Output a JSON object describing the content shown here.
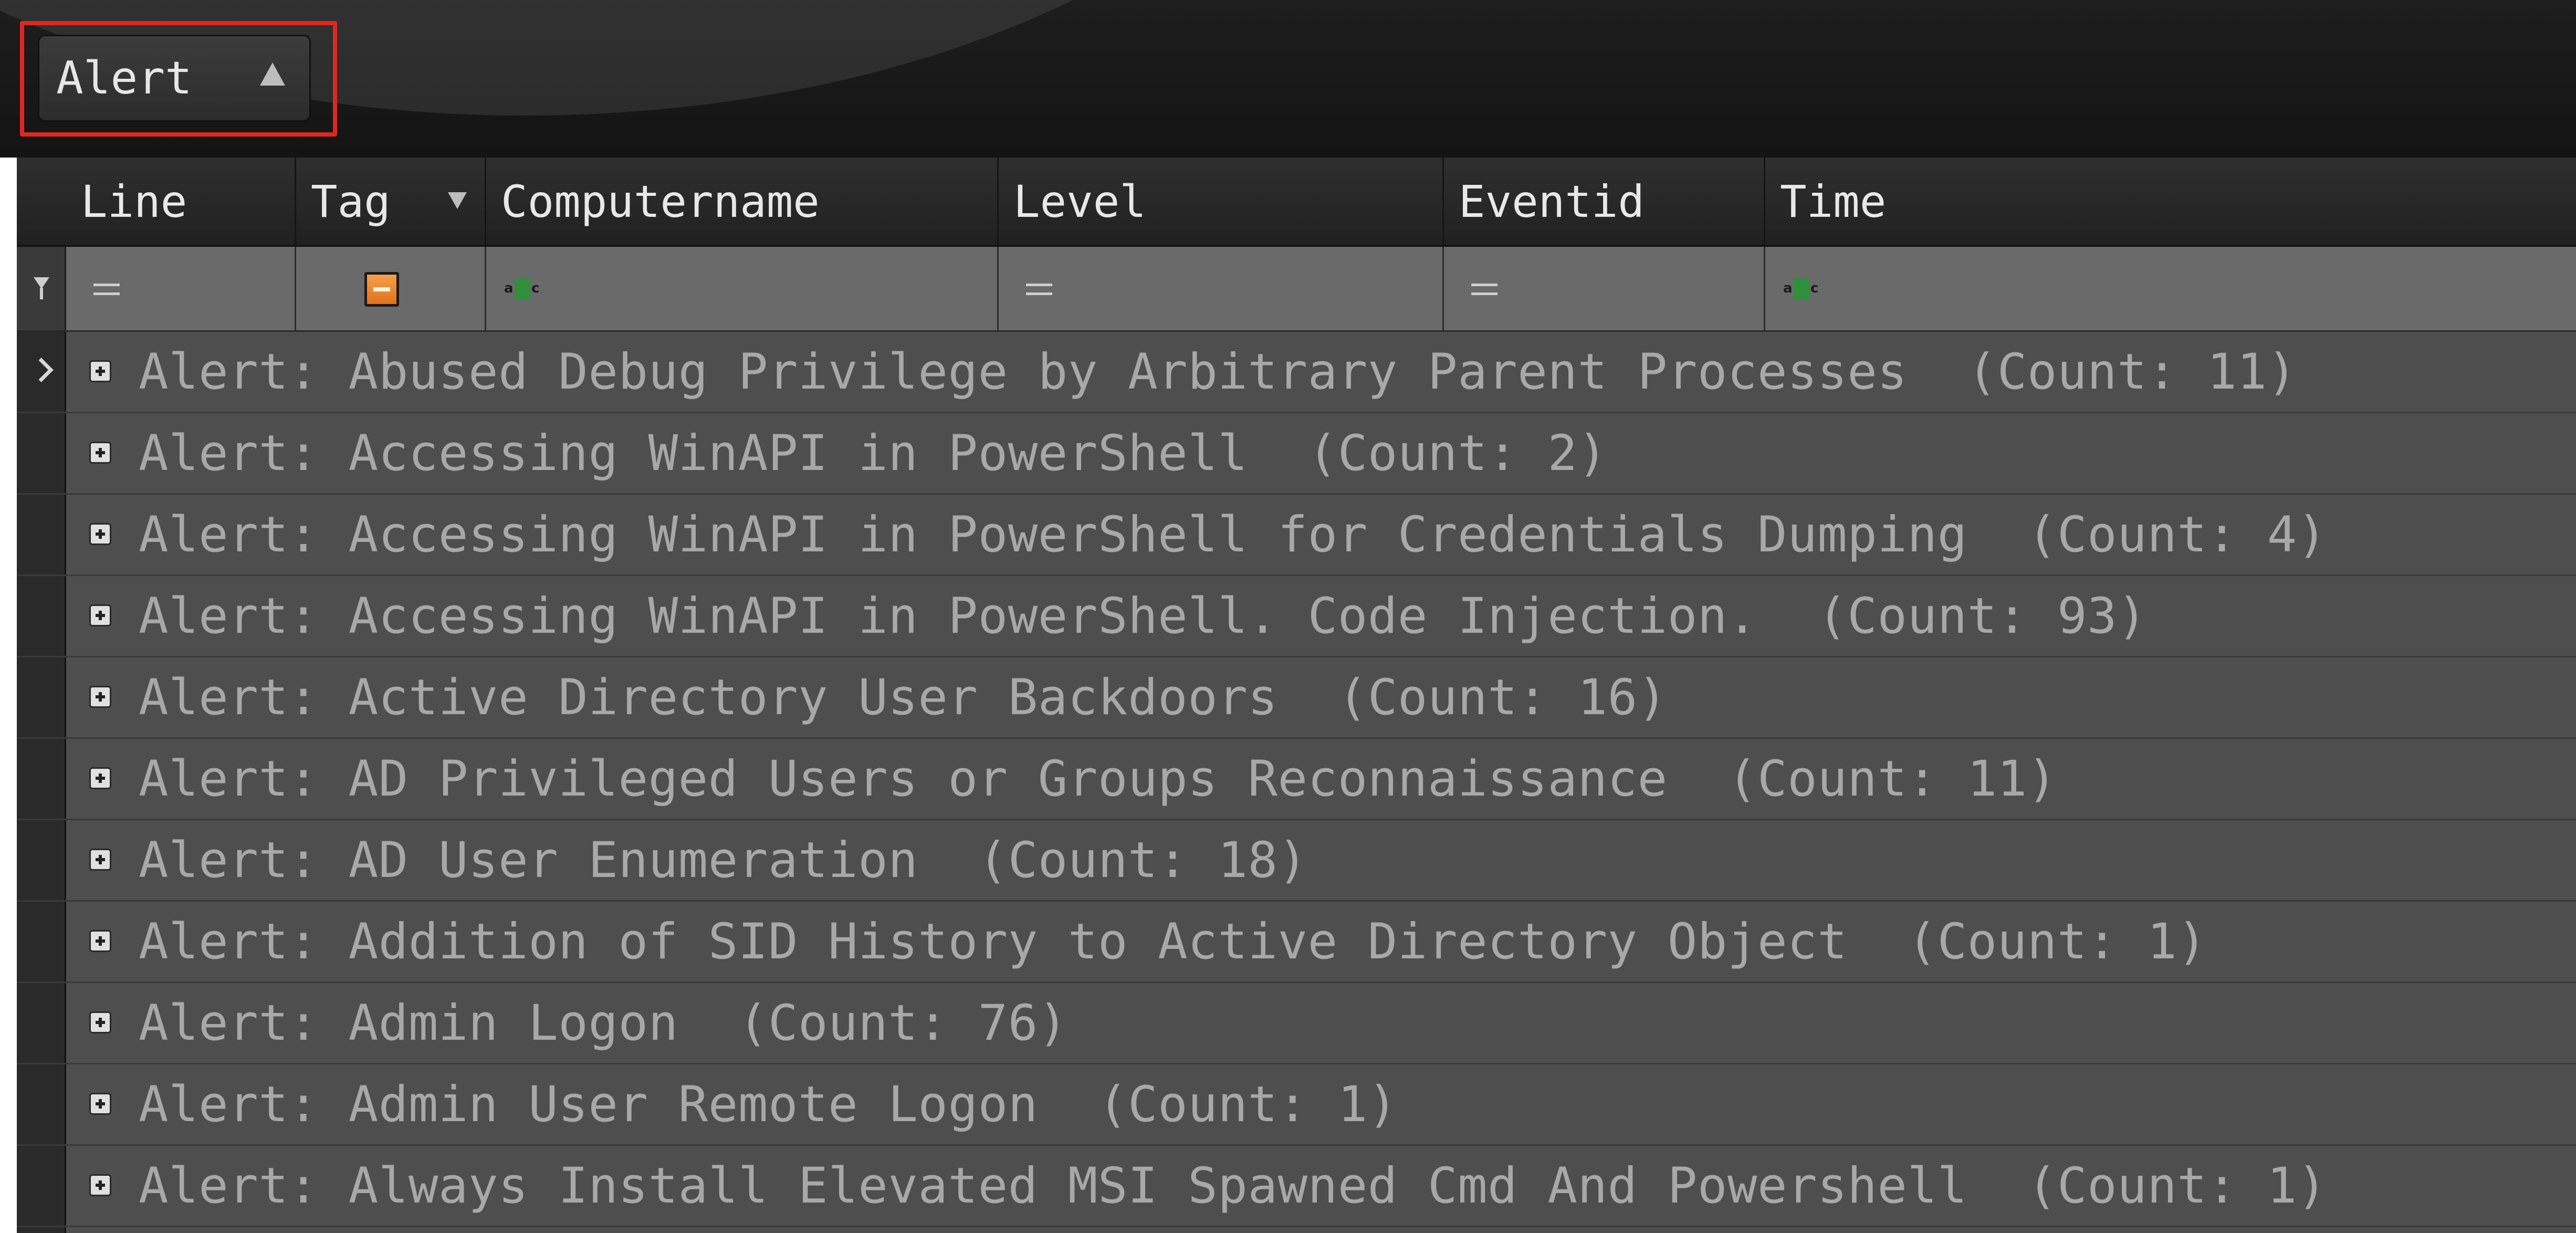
{
  "group_panel": {
    "chip_label": "Alert",
    "sort_icon": "triangle-up-icon",
    "highlight_color": "#e0281e"
  },
  "grid": {
    "columns": [
      {
        "label": "Line",
        "filter_icon": "equals-icon"
      },
      {
        "label": "Tag",
        "filter_icon": "tag-icon",
        "dropdown_icon": "triangle-down-icon"
      },
      {
        "label": "Computername",
        "filter_icon": "abc-icon"
      },
      {
        "label": "Level",
        "filter_icon": "equals-icon"
      },
      {
        "label": "Eventid",
        "filter_icon": "equals-icon"
      },
      {
        "label": "Time",
        "filter_icon": "abc-icon"
      }
    ],
    "filter_row_icon": "funnel-icon",
    "groups": [
      {
        "prefix": "Alert: ",
        "name": "Abused Debug Privilege by Arbitrary Parent Processes",
        "count_text": "(Count: 11)"
      },
      {
        "prefix": "Alert: ",
        "name": "Accessing WinAPI in PowerShell",
        "count_text": "(Count: 2)"
      },
      {
        "prefix": "Alert: ",
        "name": "Accessing WinAPI in PowerShell for Credentials Dumping",
        "count_text": "(Count: 4)"
      },
      {
        "prefix": "Alert: ",
        "name": "Accessing WinAPI in PowerShell. Code Injection.",
        "count_text": "(Count: 93)"
      },
      {
        "prefix": "Alert: ",
        "name": "Active Directory User Backdoors",
        "count_text": "(Count: 16)"
      },
      {
        "prefix": "Alert: ",
        "name": "AD Privileged Users or Groups Reconnaissance",
        "count_text": "(Count: 11)"
      },
      {
        "prefix": "Alert: ",
        "name": "AD User Enumeration",
        "count_text": "(Count: 18)"
      },
      {
        "prefix": "Alert: ",
        "name": "Addition of SID History to Active Directory Object",
        "count_text": "(Count: 1)"
      },
      {
        "prefix": "Alert: ",
        "name": "Admin Logon",
        "count_text": "(Count: 76)"
      },
      {
        "prefix": "Alert: ",
        "name": "Admin User Remote Logon",
        "count_text": "(Count: 1)"
      },
      {
        "prefix": "Alert: ",
        "name": "Always Install Elevated MSI Spawned Cmd And Powershell",
        "count_text": "(Count: 1)"
      }
    ]
  }
}
